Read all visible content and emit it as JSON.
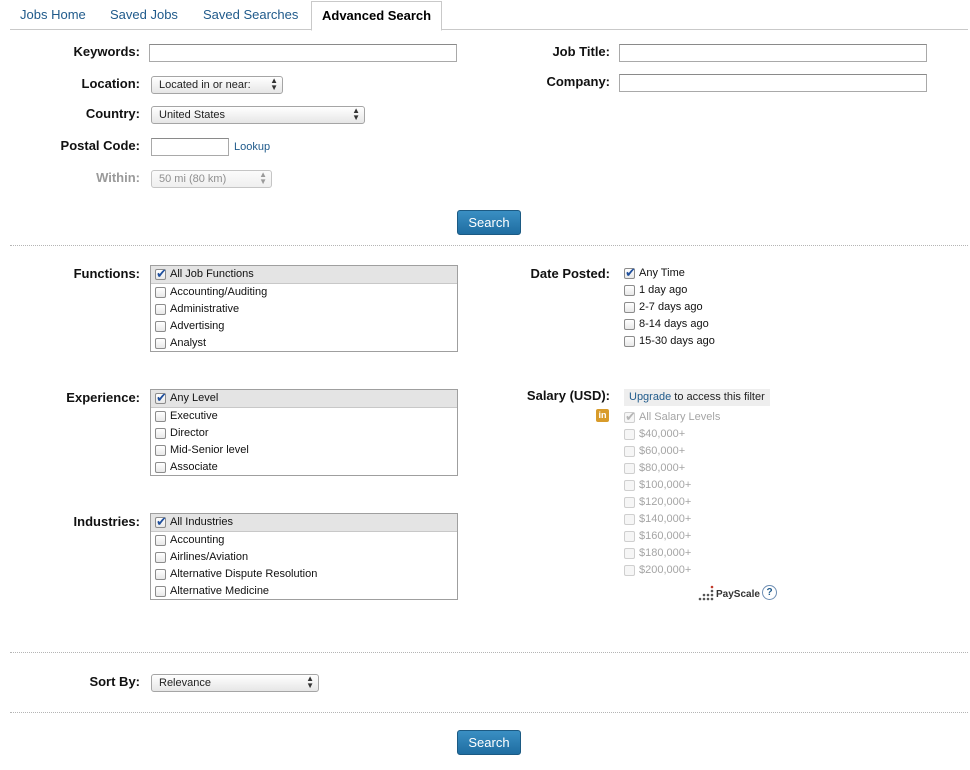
{
  "tabs": [
    {
      "label": "Jobs Home",
      "active": false
    },
    {
      "label": "Saved Jobs",
      "active": false
    },
    {
      "label": "Saved Searches",
      "active": false
    },
    {
      "label": "Advanced Search",
      "active": true
    }
  ],
  "form": {
    "keywords_label": "Keywords:",
    "keywords_value": "",
    "job_title_label": "Job Title:",
    "job_title_value": "",
    "location_label": "Location:",
    "location_value": "Located in or near:",
    "company_label": "Company:",
    "company_value": "",
    "country_label": "Country:",
    "country_value": "United States",
    "postal_label": "Postal Code:",
    "postal_value": "",
    "lookup_link": "Lookup",
    "within_label": "Within:",
    "within_value": "50 mi (80 km)",
    "search_button": "Search"
  },
  "filters": {
    "functions": {
      "label": "Functions:",
      "items": [
        {
          "text": "All Job Functions",
          "checked": true
        },
        {
          "text": "Accounting/Auditing",
          "checked": false
        },
        {
          "text": "Administrative",
          "checked": false
        },
        {
          "text": "Advertising",
          "checked": false
        },
        {
          "text": "Analyst",
          "checked": false
        }
      ]
    },
    "experience": {
      "label": "Experience:",
      "items": [
        {
          "text": "Any Level",
          "checked": true
        },
        {
          "text": "Executive",
          "checked": false
        },
        {
          "text": "Director",
          "checked": false
        },
        {
          "text": "Mid-Senior level",
          "checked": false
        },
        {
          "text": "Associate",
          "checked": false
        }
      ]
    },
    "industries": {
      "label": "Industries:",
      "items": [
        {
          "text": "All Industries",
          "checked": true
        },
        {
          "text": "Accounting",
          "checked": false
        },
        {
          "text": "Airlines/Aviation",
          "checked": false
        },
        {
          "text": "Alternative Dispute Resolution",
          "checked": false
        },
        {
          "text": "Alternative Medicine",
          "checked": false
        }
      ]
    },
    "date_posted": {
      "label": "Date Posted:",
      "items": [
        {
          "text": "Any Time",
          "checked": true
        },
        {
          "text": "1 day ago",
          "checked": false
        },
        {
          "text": "2-7 days ago",
          "checked": false
        },
        {
          "text": "8-14 days ago",
          "checked": false
        },
        {
          "text": "15-30 days ago",
          "checked": false
        }
      ]
    },
    "salary": {
      "label": "Salary (USD):",
      "upgrade_link": "Upgrade",
      "upgrade_text": " to access this filter",
      "linkedin_icon_text": "in",
      "items": [
        {
          "text": "All Salary Levels",
          "checked": true
        },
        {
          "text": "$40,000+",
          "checked": false
        },
        {
          "text": "$60,000+",
          "checked": false
        },
        {
          "text": "$80,000+",
          "checked": false
        },
        {
          "text": "$100,000+",
          "checked": false
        },
        {
          "text": "$120,000+",
          "checked": false
        },
        {
          "text": "$140,000+",
          "checked": false
        },
        {
          "text": "$160,000+",
          "checked": false
        },
        {
          "text": "$180,000+",
          "checked": false
        },
        {
          "text": "$200,000+",
          "checked": false
        }
      ],
      "payscale_label": "PayScale",
      "help_label": "?"
    }
  },
  "sort": {
    "label": "Sort By:",
    "value": "Relevance"
  },
  "bottom_search_button": "Search",
  "colors": {
    "link": "#1f5a8b",
    "button": "#2a7cb3",
    "linkedin_icon": "#d89b2a"
  }
}
